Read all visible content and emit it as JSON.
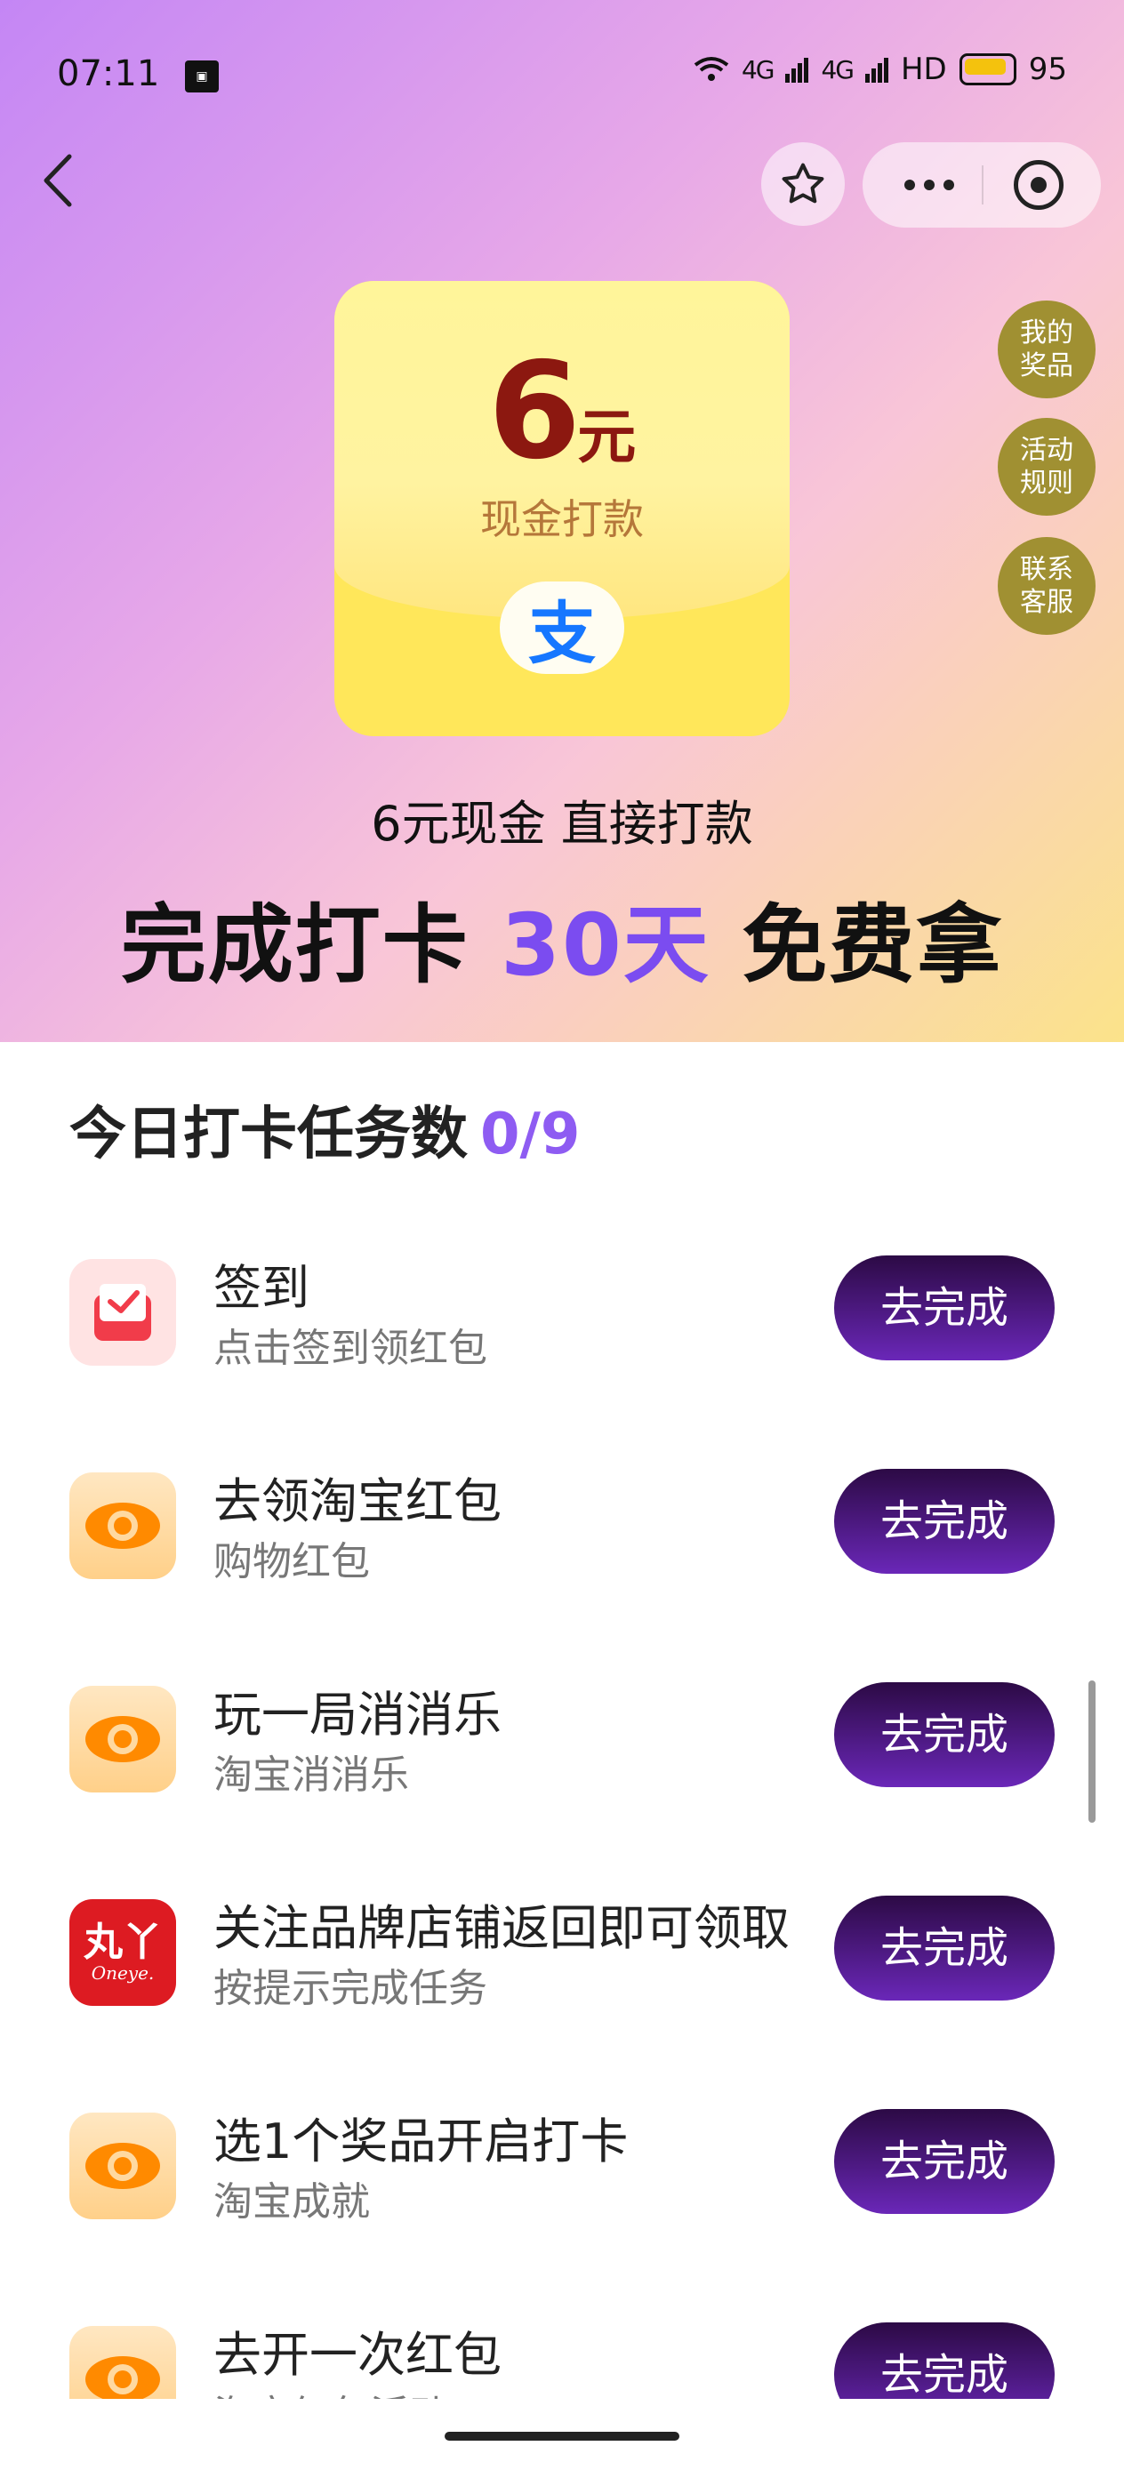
{
  "status_bar": {
    "time": "07:11",
    "notification_icon": "app-notification-icon",
    "signal_1": "4G",
    "signal_2": "4G",
    "hd": "HD",
    "battery": "95"
  },
  "nav": {
    "back_icon": "chevron-left-icon",
    "favorite_icon": "star-icon",
    "more_icon": "more-dots-icon",
    "record_icon": "target-icon"
  },
  "prize": {
    "amount": "6",
    "unit": "元",
    "subtitle": "现金打款",
    "payment_icon": "支"
  },
  "side_buttons": [
    {
      "label": "我的\n奖品",
      "line1": "我的",
      "line2": "奖品"
    },
    {
      "label": "活动\n规则",
      "line1": "活动",
      "line2": "规则"
    },
    {
      "label": "联系\n客服",
      "line1": "联系",
      "line2": "客服"
    }
  ],
  "hero": {
    "tagline": "6元现金 直接打款",
    "headline_before": "完成打卡 ",
    "headline_highlight": "30天",
    "headline_after": " 免费拿"
  },
  "tasks_header": {
    "title": "今日打卡任务数",
    "count": "0/9"
  },
  "tasks": [
    {
      "name": "签到",
      "desc": "点击签到领红包",
      "icon": "calendar-check-icon",
      "button": "去完成"
    },
    {
      "name": "去领淘宝红包",
      "desc": "购物红包",
      "icon": "taobao-eye-icon",
      "button": "去完成"
    },
    {
      "name": "玩一局消消乐",
      "desc": "淘宝消消乐",
      "icon": "taobao-eye-icon",
      "button": "去完成"
    },
    {
      "name": "关注品牌店铺返回即可领取",
      "desc": "按提示完成任务",
      "icon": "brand-logo-icon",
      "brand_cn": "丸丫",
      "brand_en": "Oneye.",
      "button": "去完成"
    },
    {
      "name": "选1个奖品开启打卡",
      "desc": "淘宝成就",
      "icon": "taobao-eye-icon",
      "button": "去完成"
    },
    {
      "name": "去开一次红包",
      "desc": "淘宝红包活动",
      "icon": "taobao-eye-icon",
      "button": "去完成"
    }
  ],
  "colors": {
    "accent_purple": "#7b4cf0",
    "button_dark": "#2c0a45",
    "side_button": "#a09032",
    "prize_red": "#8c1810"
  }
}
